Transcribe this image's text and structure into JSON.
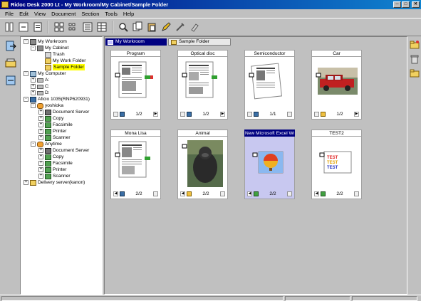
{
  "window": {
    "title": "Ridoc Desk 2000 Lt - My Workroom/My Cabinet/Sample Folder"
  },
  "menubar": [
    "File",
    "Edit",
    "View",
    "Document",
    "Section",
    "Tools",
    "Help"
  ],
  "tree": [
    {
      "label": "My Workroom",
      "icon": "workroom-icon",
      "exp": "-"
    },
    {
      "label": "My Cabinet",
      "icon": "cabinet-icon",
      "exp": "-"
    },
    {
      "label": "Trash",
      "icon": "trash-icon",
      "exp": ""
    },
    {
      "label": "My Work Folder",
      "icon": "folder-icon",
      "exp": ""
    },
    {
      "label": "Sample Folder",
      "icon": "folder-icon",
      "exp": "",
      "selected": true
    },
    {
      "label": "My Computer",
      "icon": "computer-icon",
      "exp": "-"
    },
    {
      "label": "A:",
      "icon": "drive-icon",
      "exp": "+"
    },
    {
      "label": "C:",
      "icon": "drive-icon",
      "exp": "+"
    },
    {
      "label": "D:",
      "icon": "drive-icon",
      "exp": "+"
    },
    {
      "label": "Aficio 1035(RNP620931)",
      "icon": "aficio-icon",
      "exp": "-"
    },
    {
      "label": "yoshioka",
      "icon": "user-icon",
      "exp": "-"
    },
    {
      "label": "Document Server",
      "icon": "document-server-icon",
      "exp": "+"
    },
    {
      "label": "Copy",
      "icon": "copy-icon",
      "exp": "+"
    },
    {
      "label": "Facsimile",
      "icon": "facsimile-icon",
      "exp": "+"
    },
    {
      "label": "Printer",
      "icon": "printer-icon",
      "exp": "+"
    },
    {
      "label": "Scanner",
      "icon": "scanner-icon",
      "exp": "+"
    },
    {
      "label": "Anytime",
      "icon": "user-icon",
      "exp": "-"
    },
    {
      "label": "Document Server",
      "icon": "document-server-icon",
      "exp": "+"
    },
    {
      "label": "Copy",
      "icon": "copy-icon",
      "exp": "+"
    },
    {
      "label": "Facsimile",
      "icon": "facsimile-icon",
      "exp": "+"
    },
    {
      "label": "Printer",
      "icon": "printer-icon",
      "exp": "+"
    },
    {
      "label": "Scanner",
      "icon": "scanner-icon",
      "exp": "+"
    },
    {
      "label": "Delivery server(kanon)",
      "icon": "delivery-server-icon",
      "exp": "+"
    }
  ],
  "breadcrumbs": [
    "My Workroom",
    "Sample Folder"
  ],
  "documents": [
    {
      "title": "Program",
      "page": "1/2",
      "thumb": "doc"
    },
    {
      "title": "Optical disc",
      "page": "1/2",
      "thumb": "doc"
    },
    {
      "title": "Semiconductor",
      "page": "1/1",
      "thumb": "doc"
    },
    {
      "title": "Car",
      "page": "1/2",
      "thumb": "car"
    },
    {
      "title": "Mona Lisa",
      "page": "2/2",
      "thumb": "doc"
    },
    {
      "title": "Animal",
      "page": "2/2",
      "thumb": "gorilla"
    },
    {
      "title": "New Microsoft Excel Works...",
      "page": "2/2",
      "thumb": "balloon",
      "selected": true
    },
    {
      "title": "TEST2",
      "page": "2/2",
      "thumb": "test",
      "thumb_text": [
        "TEST",
        "TEST",
        "TEST"
      ]
    }
  ],
  "colors": {
    "selection": "#000080",
    "tree_highlight": "#ffff00",
    "face": "#c0c0c0"
  }
}
